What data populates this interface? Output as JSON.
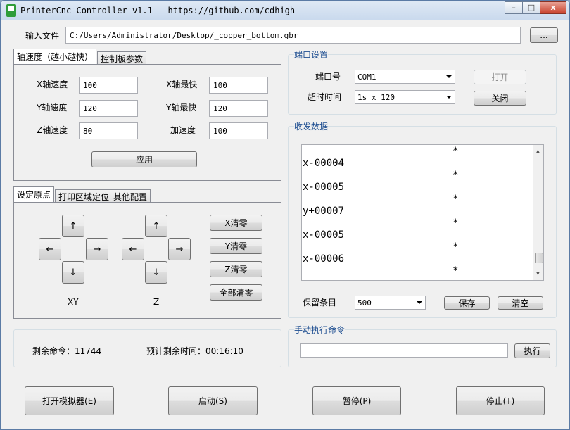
{
  "window": {
    "title": "PrinterCnc Controller v1.1 - https://github.com/cdhigh",
    "min_glyph": "–",
    "max_glyph": "□",
    "close_glyph": "x"
  },
  "file": {
    "label": "输入文件",
    "path": "C:/Users/Administrator/Desktop/_copper_bottom.gbr",
    "browse_label": "..."
  },
  "speed_tabs": {
    "tabs": [
      "轴速度（越小越快）",
      "控制板参数"
    ],
    "x_speed_label": "X轴速度",
    "x_speed": "100",
    "y_speed_label": "Y轴速度",
    "y_speed": "120",
    "z_speed_label": "Z轴速度",
    "z_speed": "80",
    "x_max_label": "X轴最快",
    "x_max": "100",
    "y_max_label": "Y轴最快",
    "y_max": "120",
    "accel_label": "加速度",
    "accel": "100",
    "apply_label": "应用"
  },
  "origin_tabs": {
    "tabs": [
      "设定原点",
      "打印区域定位",
      "其他配置"
    ],
    "up": "↑",
    "down": "↓",
    "left": "←",
    "right": "→",
    "xy_label": "XY",
    "z_label": "Z",
    "x_zero": "X清零",
    "y_zero": "Y清零",
    "z_zero": "Z清零",
    "all_zero": "全部清零"
  },
  "status": {
    "remaining_cmds": "剩余命令：11744",
    "remaining_time": "预计剩余时间：00:16:10"
  },
  "port": {
    "group_title": "端口设置",
    "port_label": "端口号",
    "port_value": "COM1",
    "timeout_label": "超时时间",
    "timeout_value": "1s x 120",
    "open_label": "打开",
    "close_label": "关闭"
  },
  "data": {
    "group_title": "收发数据",
    "lines": [
      {
        "text": "*",
        "indent": true
      },
      {
        "text": "x-00004",
        "indent": false
      },
      {
        "text": "*",
        "indent": true
      },
      {
        "text": "x-00005",
        "indent": false
      },
      {
        "text": "*",
        "indent": true
      },
      {
        "text": "y+00007",
        "indent": false
      },
      {
        "text": "*",
        "indent": true
      },
      {
        "text": "x-00005",
        "indent": false
      },
      {
        "text": "*",
        "indent": true
      },
      {
        "text": "x-00006",
        "indent": false
      },
      {
        "text": "*",
        "indent": true
      }
    ],
    "keep_label": "保留条目",
    "keep_value": "500",
    "save_label": "保存",
    "clear_label": "清空"
  },
  "manual": {
    "group_title": "手动执行命令",
    "cmd_value": "",
    "exec_label": "执行"
  },
  "bottom": {
    "open_sim": "打开模拟器(E)",
    "start": "启动(S)",
    "pause": "暂停(P)",
    "stop": "停止(T)"
  }
}
